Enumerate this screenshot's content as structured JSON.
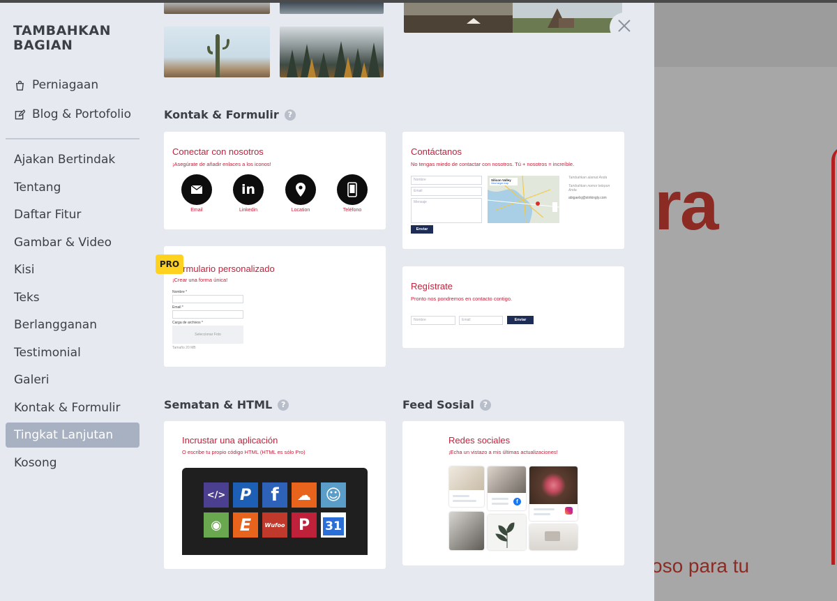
{
  "sidebar": {
    "title": "TAMBAHKAN BAGIAN",
    "top_items": [
      {
        "label": "Perniagaan",
        "icon": "shopping-bag-icon"
      },
      {
        "label": "Blog & Portofolio",
        "icon": "edit-icon"
      }
    ],
    "items": [
      {
        "label": "Ajakan Bertindak"
      },
      {
        "label": "Tentang"
      },
      {
        "label": "Daftar Fitur"
      },
      {
        "label": "Gambar & Video"
      },
      {
        "label": "Kisi"
      },
      {
        "label": "Teks"
      },
      {
        "label": "Berlangganan"
      },
      {
        "label": "Testimonial"
      },
      {
        "label": "Galeri"
      },
      {
        "label": "Kontak & Formulir"
      },
      {
        "label": "Tingkat Lanjutan",
        "active": true
      },
      {
        "label": "Kosong"
      }
    ]
  },
  "sections": {
    "contact": {
      "heading": "Kontak & Formulir",
      "cards": {
        "connect": {
          "title": "Conectar con nosotros",
          "subtitle": "¡Asegúrate de añadir enlaces a los iconos!",
          "icons": [
            {
              "label": "Email",
              "icon": "envelope-icon"
            },
            {
              "label": "Linkedin",
              "icon": "linkedin-icon"
            },
            {
              "label": "Location",
              "icon": "location-pin-icon"
            },
            {
              "label": "Teléfono",
              "icon": "phone-icon"
            }
          ]
        },
        "contactanos": {
          "title": "Contáctanos",
          "subtitle": "No tengas miedo de contactar con nosotros. Tú + nosotros = increíble.",
          "field_name": "Nombre",
          "field_email": "Email",
          "field_message": "Mensaje",
          "button": "Enviar",
          "map_label": "Silicon Valley",
          "map_sub": "View larger map",
          "side_1": "Tambahkan alamat Anda",
          "side_2": "Tambahkan nomor telepon Anda",
          "side_3": "abigaelsj@strikingly.com"
        },
        "custom_form": {
          "badge": "PRO",
          "title": "Formulario personalizado",
          "subtitle": "¡Crear una forma única!",
          "label_name": "Nombre *",
          "label_email": "Email *",
          "label_upload": "Carga de archivos *",
          "upload_text": "Seleccionar Foto",
          "note": "Tamaño 20 MB"
        },
        "register": {
          "title": "Regístrate",
          "subtitle": "Pronto nos pondremos en contacto contigo.",
          "field_name": "Nombre",
          "field_email": "Email",
          "button": "Enviar"
        }
      }
    },
    "embed": {
      "heading": "Sematan & HTML",
      "card": {
        "title": "Incrustar una aplicación",
        "subtitle": "O escribe tu propio código HTML (HTML es sólo Pro)",
        "tiles": [
          {
            "icon": "code-icon",
            "text": "</>",
            "color": "#4b3f8f"
          },
          {
            "icon": "paypal-icon",
            "text": "P",
            "color": "#1d5fb5"
          },
          {
            "icon": "facebook-icon",
            "text": "f",
            "color": "#2e62b8"
          },
          {
            "icon": "soundcloud-icon",
            "text": "☁",
            "color": "#e8631b"
          },
          {
            "icon": "mailchimp-icon",
            "text": "☺",
            "color": "#5b9dc9"
          },
          {
            "icon": "google-maps-icon",
            "text": "◉",
            "color": "#6aa84f"
          },
          {
            "icon": "eventbrite-icon",
            "text": "E",
            "color": "#e8631b"
          },
          {
            "icon": "wufoo-icon",
            "text": "Wufoo",
            "color": "#c0392b"
          },
          {
            "icon": "pinterest-icon",
            "text": "P",
            "color": "#c0213a"
          },
          {
            "icon": "calendar-icon",
            "text": "31",
            "color": "#2b6fd6"
          }
        ]
      }
    },
    "social": {
      "heading": "Feed Sosial",
      "card": {
        "title": "Redes sociales",
        "subtitle": "¡Echa un vistazo a mis últimas actualizaciones!"
      }
    }
  },
  "colors": {
    "accent_red": "#c0213a",
    "navy": "#1e2d55",
    "pro_yellow": "#ffd21f",
    "active_item": "#a7b1c2"
  },
  "background_site": {
    "hero_fragment": "ra",
    "sub_fragment": "oso para tu"
  }
}
